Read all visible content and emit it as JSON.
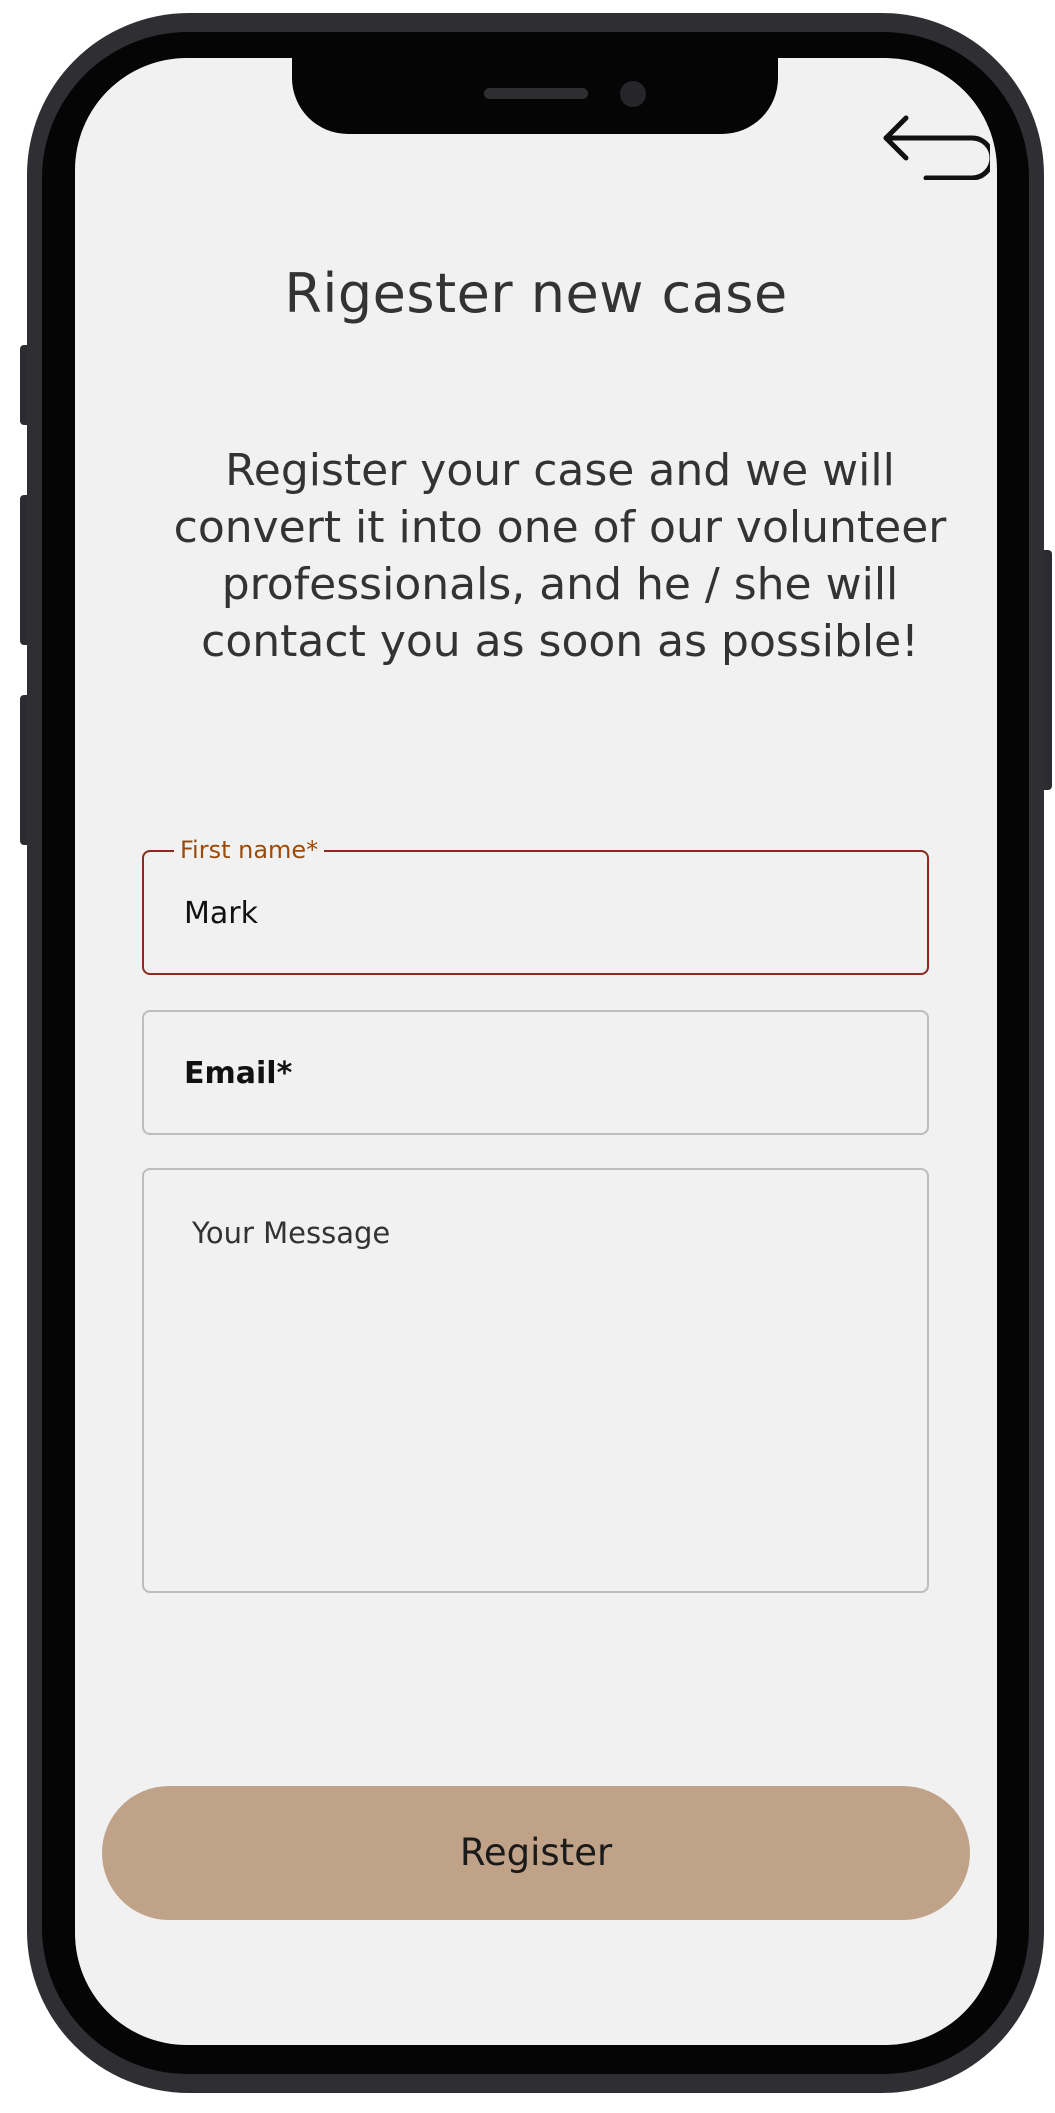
{
  "header": {
    "title": "Rigester new case",
    "back_icon": "back-arrow-icon"
  },
  "intro": {
    "line1": "Register your case and we will",
    "line2": "convert it into one of our volunteer",
    "line3": "professionals, and he / she will",
    "line4": "contact you as soon as possible!"
  },
  "form": {
    "first_name": {
      "label": "First name*",
      "value": "Mark"
    },
    "email": {
      "placeholder": "Email*"
    },
    "message": {
      "placeholder": "Your Message"
    },
    "submit_label": "Register"
  },
  "colors": {
    "screen_background": "#f1f1f1",
    "active_border": "#8b2a1e",
    "active_label": "#9a4a0a",
    "button_fill": "#bfa288"
  }
}
